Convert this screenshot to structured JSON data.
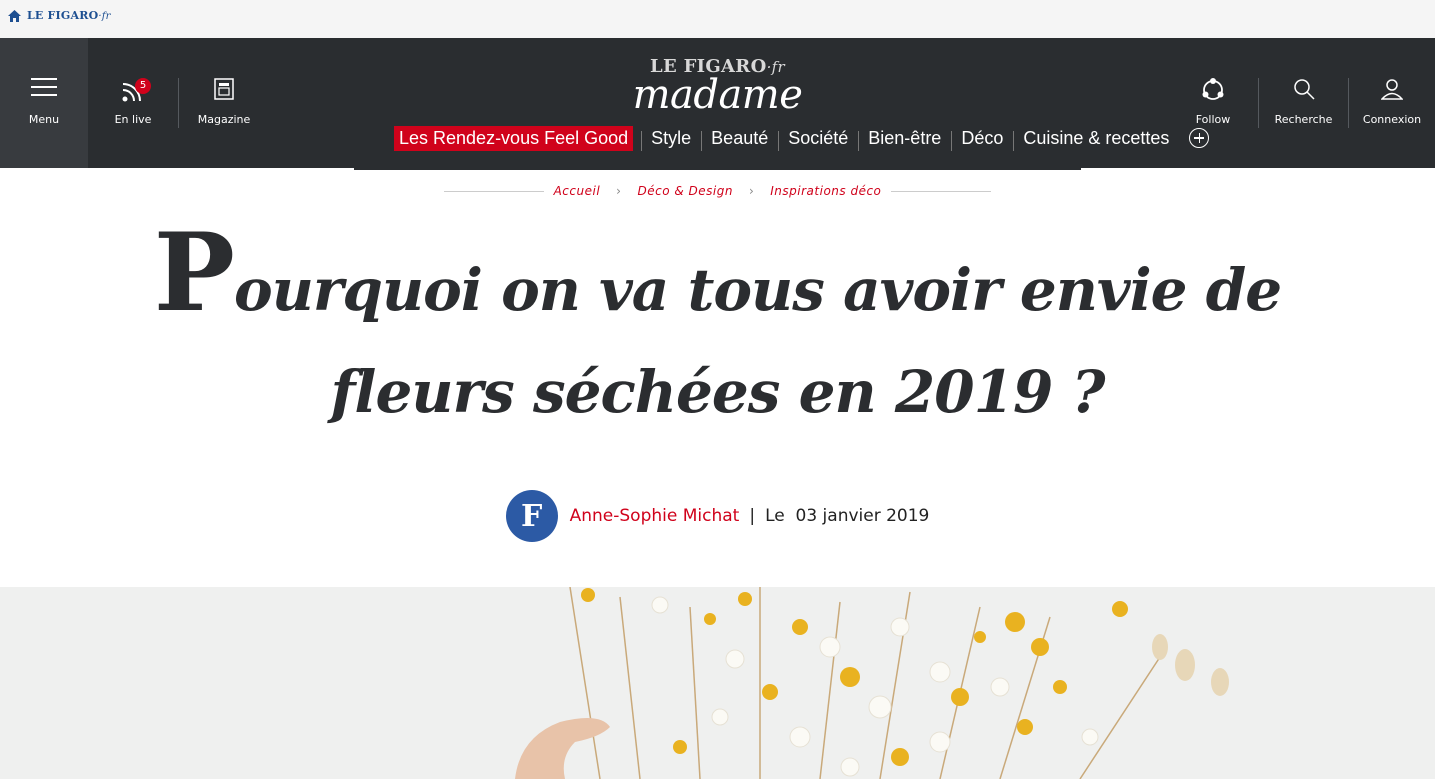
{
  "topbar": {
    "brand": "LE FIGARO",
    "brand_suffix": "·fr"
  },
  "nav": {
    "menu_label": "Menu",
    "live_label": "En live",
    "live_count": "5",
    "magazine_label": "Magazine",
    "logo_top": "LE FIGARO",
    "logo_top_suffix": "·fr",
    "logo_main": "madame",
    "follow_label": "Follow",
    "search_label": "Recherche",
    "login_label": "Connexion",
    "categories": [
      "Les Rendez-vous Feel Good",
      "Style",
      "Beauté",
      "Société",
      "Bien-être",
      "Déco",
      "Cuisine & recettes"
    ]
  },
  "breadcrumb": [
    "Accueil",
    "Déco & Design",
    "Inspirations déco"
  ],
  "article": {
    "title_initial": "P",
    "title_rest_line1": "ourquoi on va tous avoir envie de",
    "title_line2": "fleurs séchées en 2019 ?",
    "author": "Anne-Sophie Michat",
    "date_prefix": "Le",
    "date": "03 janvier 2019",
    "avatar_letter": "F"
  },
  "colors": {
    "accent": "#d0021b",
    "nav_bg": "#2a2d30",
    "brand_blue": "#1d4f91"
  }
}
